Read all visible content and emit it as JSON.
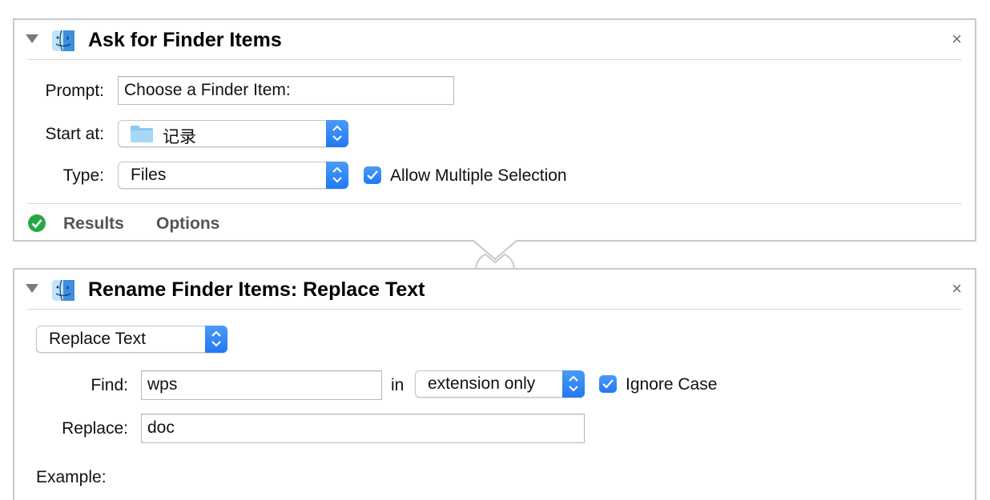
{
  "actions": [
    {
      "title": "Ask for Finder Items",
      "close_glyph": "×",
      "prompt_label": "Prompt:",
      "prompt_value": "Choose a Finder Item:",
      "start_at_label": "Start at:",
      "start_at_value": "记录",
      "type_label": "Type:",
      "type_value": "Files",
      "allow_multiple_label": "Allow Multiple Selection",
      "allow_multiple_checked": true,
      "footer_tabs": [
        "Results",
        "Options"
      ],
      "status": "success"
    },
    {
      "title": "Rename Finder Items: Replace Text",
      "close_glyph": "×",
      "mode_value": "Replace Text",
      "find_label": "Find:",
      "find_value": "wps",
      "in_label": "in",
      "scope_value": "extension only",
      "ignore_case_label": "Ignore Case",
      "ignore_case_checked": true,
      "replace_label": "Replace:",
      "replace_value": "doc",
      "example_label": "Example:"
    }
  ],
  "icons": {
    "disclosure": "disclosure-triangle-icon",
    "action": "finder-icon",
    "close": "close-icon",
    "folder": "folder-icon",
    "stepper": "popup-stepper-icon",
    "checkbox": "checkmark-icon",
    "status": "success-check-icon"
  },
  "colors": {
    "accent": "#2278f2",
    "success": "#27a844",
    "panel_border": "#c9c9c9",
    "folder": "#8cc8f0"
  }
}
